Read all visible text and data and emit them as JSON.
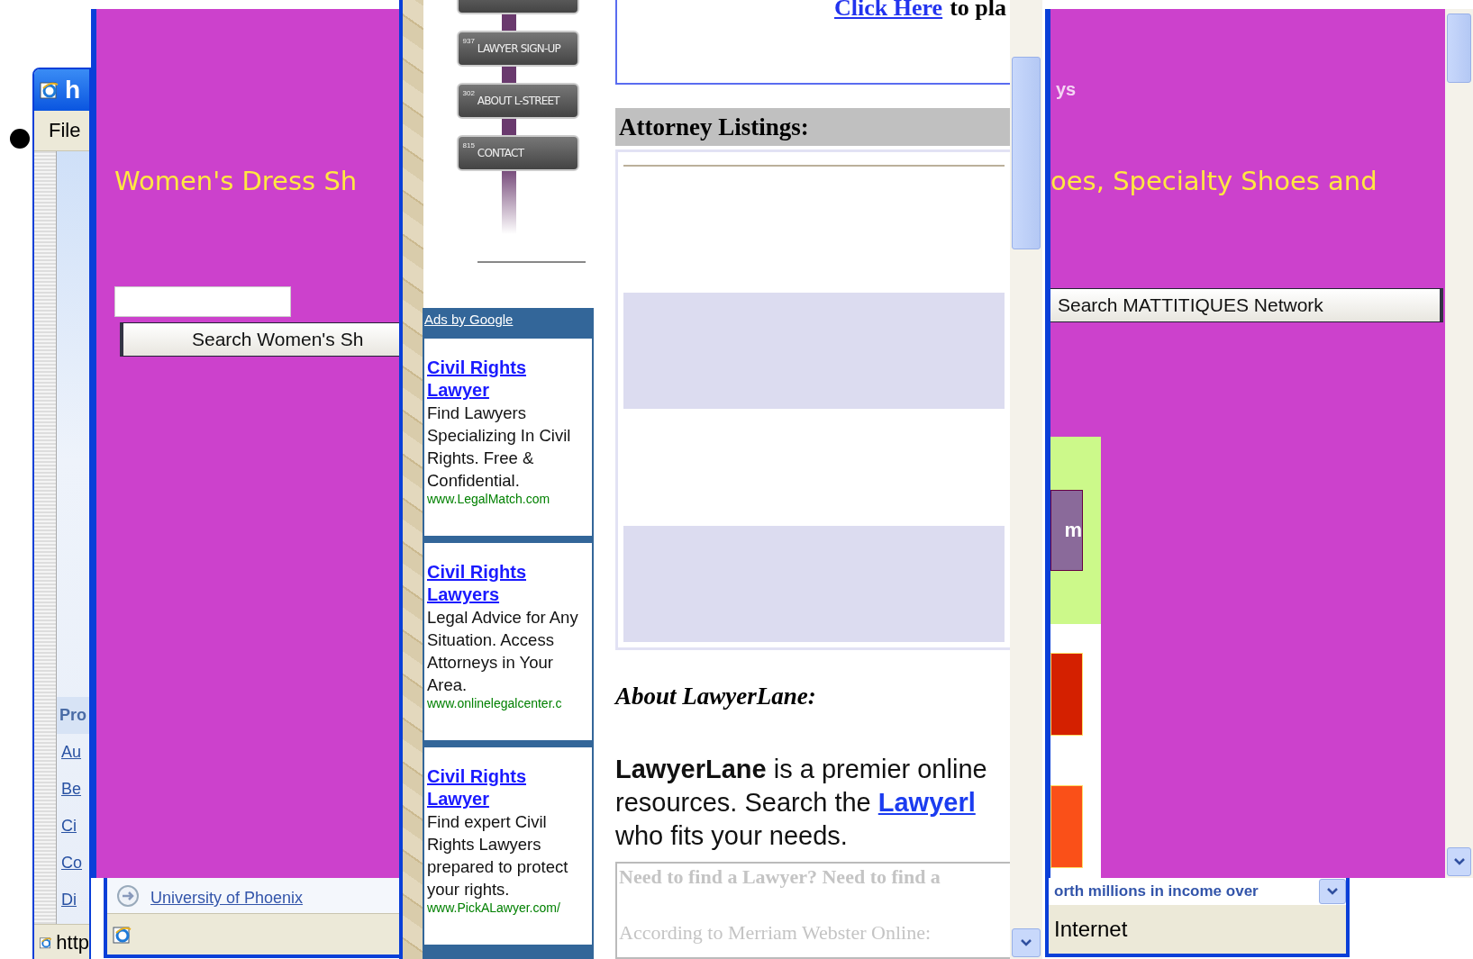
{
  "back_window": {
    "title": "h",
    "menu": [
      "File"
    ],
    "panel_heading": "Pro",
    "links": [
      "Au",
      "Be",
      "Ci",
      "Co",
      "Di"
    ],
    "status": "http"
  },
  "second_window": {
    "link": "University of Phoenix"
  },
  "left_shoe_window": {
    "heading": "Women's Dress Sh",
    "search_button": "Search Women's Sh"
  },
  "lawyer_page": {
    "nav_signs": [
      {
        "number": "937",
        "label": "LAWYER SIGN-UP"
      },
      {
        "number": "302",
        "label": "ABOUT L-STREET"
      },
      {
        "number": "815",
        "label": "CONTACT"
      }
    ],
    "ads_header": "Ads by Google",
    "ads": [
      {
        "title": "Civil Rights Lawyer",
        "text": "Find Lawyers Specializing In Civil Rights. Free & Confidential.",
        "url": "www.LegalMatch.com"
      },
      {
        "title": "Civil Rights Lawyers",
        "text": "Legal Advice for Any Situation. Access Attorneys in Your Area.",
        "url": "www.onlinelegalcenter.c"
      },
      {
        "title": "Civil Rights Lawyer",
        "text": "Find expert Civil Rights Lawyers prepared to protect your rights.",
        "url": "www.PickALawyer.com/"
      }
    ],
    "top_link": "Click Here",
    "top_text": "to pla",
    "listings_heading": "Attorney Listings:",
    "about_heading": "About LawyerLane:",
    "about_lines": [
      "**LawyerLane** is a premier online",
      "resources. Search the ",
      "who fits your needs."
    ],
    "about_link": "Lawyerl",
    "textarea_lines": [
      "Need to find a Lawyer? Need to find a",
      "According to Merriam Webster Online:"
    ]
  },
  "right_shoe_window": {
    "faint_text": "ys",
    "heading": "oes, Specialty Shoes and",
    "search_button": "Search MATTITIQUES Network",
    "promo_letter": "m"
  },
  "bottom_strip": {
    "text": "orth millions in income over",
    "status": "Internet"
  }
}
